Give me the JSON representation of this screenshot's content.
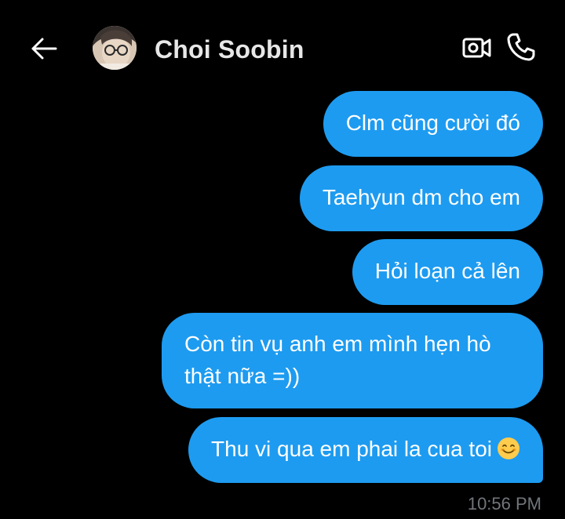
{
  "header": {
    "contact_name": "Choi Soobin",
    "back_icon": "arrow-left-icon",
    "video_icon": "video-call-icon",
    "call_icon": "phone-icon"
  },
  "messages": [
    {
      "text": "Clm cũng cười đó"
    },
    {
      "text": "Taehyun dm cho em"
    },
    {
      "text": "Hỏi loạn cả lên"
    },
    {
      "text": "Còn tin vụ anh em mình hẹn hò thật nữa =))"
    },
    {
      "text": "Thu vi qua em phai la cua toi",
      "emoji": "smiling-face-emoji"
    }
  ],
  "timestamp": "10:56 PM",
  "colors": {
    "background": "#000000",
    "bubble": "#1d9bf0",
    "timestamp": "#71767b"
  }
}
